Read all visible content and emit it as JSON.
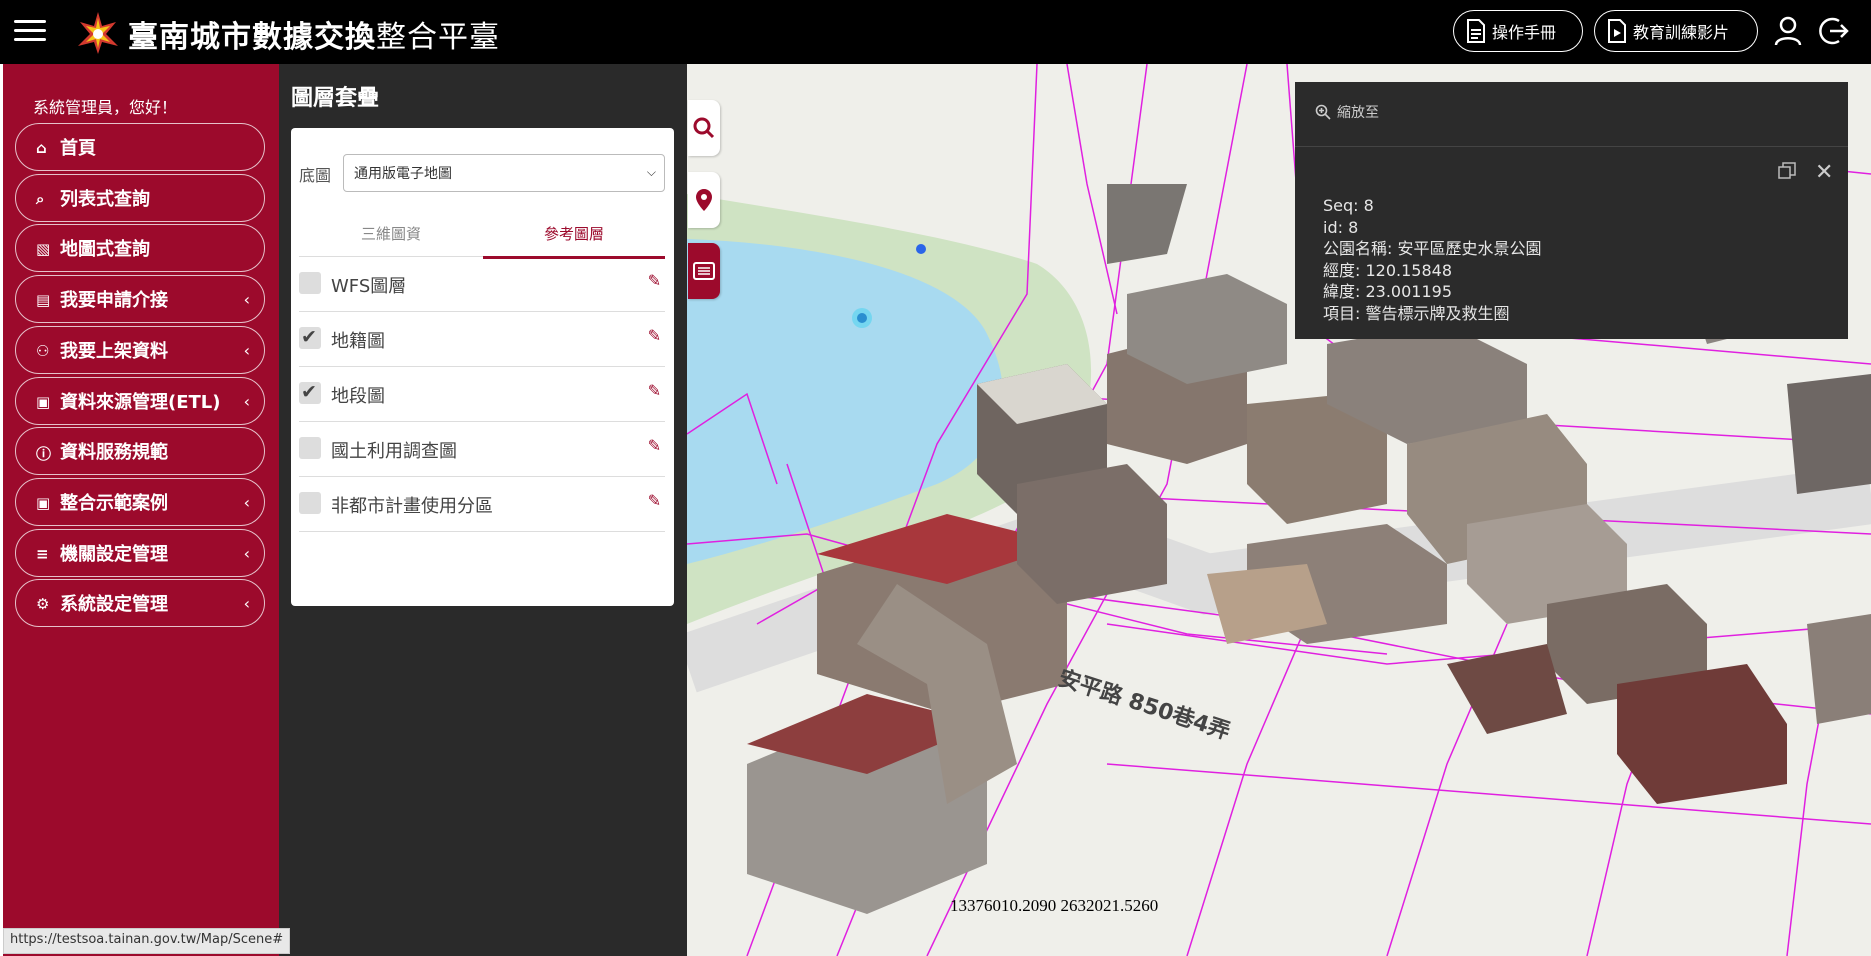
{
  "header": {
    "title_bold": "臺南城市數據交換",
    "title_light": "整合平臺",
    "manual_label": "操作手冊",
    "video_label": "教育訓練影片"
  },
  "sidebar": {
    "welcome": "系統管理員，您好！",
    "items": [
      {
        "label": "首頁",
        "has_submenu": false,
        "icon": "home-icon"
      },
      {
        "label": "列表式查詢",
        "has_submenu": false,
        "icon": "search-icon"
      },
      {
        "label": "地圖式查詢",
        "has_submenu": false,
        "icon": "map-icon"
      },
      {
        "label": "我要申請介接",
        "has_submenu": true,
        "icon": "clipboard-icon"
      },
      {
        "label": "我要上架資料",
        "has_submenu": true,
        "icon": "share-nodes-icon"
      },
      {
        "label": "資料來源管理(ETL)",
        "has_submenu": true,
        "icon": "window-icon"
      },
      {
        "label": "資料服務規範",
        "has_submenu": false,
        "icon": "info-circle-icon"
      },
      {
        "label": "整合示範案例",
        "has_submenu": true,
        "icon": "window-icon"
      },
      {
        "label": "機關設定管理",
        "has_submenu": true,
        "icon": "sliders-icon"
      },
      {
        "label": "系統設定管理",
        "has_submenu": true,
        "icon": "gear-icon"
      }
    ]
  },
  "layer_panel": {
    "title": "圖層套疊",
    "basemap_label": "底圖",
    "basemap_selected": "通用版電子地圖",
    "tabs": [
      {
        "label": "三維圖資",
        "active": false
      },
      {
        "label": "參考圖層",
        "active": true
      }
    ],
    "layers": [
      {
        "label": "WFS圖層",
        "checked": false
      },
      {
        "label": "地籍圖",
        "checked": true
      },
      {
        "label": "地段圖",
        "checked": true
      },
      {
        "label": "國土利用調查圖",
        "checked": false
      },
      {
        "label": "非都市計畫使用分區",
        "checked": false
      }
    ]
  },
  "popup": {
    "zoom_label": "縮放至",
    "lines": [
      "Seq: 8",
      "id: 8",
      "公園名稱: 安平區歷史水景公園",
      "經度: 120.15848",
      "緯度: 23.001195",
      "項目: 警告標示牌及救生圈"
    ]
  },
  "map": {
    "coordinates": "13376010.2090 2632021.5260"
  },
  "status_bar": {
    "url": "https://testsoa.tainan.gov.tw/Map/Scene#"
  },
  "colors": {
    "brand": "#9c0a2c",
    "header_bg": "#000000",
    "panel_bg": "#2a2a2a",
    "cadastral_lines": "#e020e0",
    "water": "#a8daf0"
  }
}
